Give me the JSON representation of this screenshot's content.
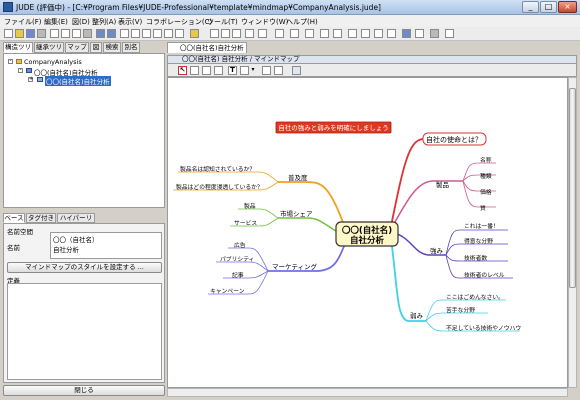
{
  "window": {
    "title": "JUDE  (評価中)  - [C:¥Program Files¥JUDE-Professional¥template¥mindmap¥CompanyAnalysis.jude]",
    "min_btn": "_",
    "max_btn": "□",
    "close_btn": "×"
  },
  "menu": [
    "ファイル(F)",
    "編集(E)",
    "図(D)",
    "整列(A)",
    "表示(V)",
    "コラボレーション(C)",
    "ツール(T)",
    "ウィンドウ(W)",
    "ヘルプ(H)"
  ],
  "left_tabs": [
    "構造ツリー",
    "継承ツリー",
    "マップ",
    "図",
    "検索",
    "別名"
  ],
  "tree": {
    "root": "CompanyAnalysis",
    "child": "〇〇(自社名)自社分析",
    "selected": "〇〇(自社名)自社分析"
  },
  "props": {
    "tabs": [
      "ベース",
      "タグ付き値",
      "ハイパーリンク"
    ],
    "namespace_label": "名前空間",
    "name_label": "名前",
    "name_value_line1": "〇〇（自社名）",
    "name_value_line2": "自社分析",
    "style_button": "マインドマップのスタイルを設定する ...",
    "definition_label": "定義",
    "close_button": "閉じる"
  },
  "editor": {
    "tab_label": "〇〇(自社名)自社分析",
    "header": "〇〇(自社名) 自社分析 / マインドマップ",
    "tools": [
      "select",
      "curve",
      "line",
      "link",
      "text",
      "shape",
      "dropdown",
      "pen",
      "node",
      "image"
    ],
    "tool_text": "T"
  },
  "mindmap": {
    "center_line1": "〇〇(自社名)",
    "center_line2": "自社分析",
    "note": "自社の強みと弱みを明確にしましょう",
    "mission": "自社の使命とは？",
    "products": "製品",
    "products_items": [
      "名称",
      "種類",
      "価格",
      "質"
    ],
    "strength": "強み",
    "strength_items": [
      "これは一番！",
      "得意な分野",
      "技術者数",
      "技術者のレベル"
    ],
    "weakness": "弱み",
    "weakness_items": [
      "ここはごめんなさい。",
      "苦手な分野",
      "不足している技術やノウハウ"
    ],
    "popularity": "普及度",
    "popularity_items": [
      "製品名は認知されているか？",
      "製品はどの程度浸透しているか？"
    ],
    "share": "市場シェア",
    "share_items": [
      "製品",
      "サービス"
    ],
    "marketing": "マーケティング",
    "marketing_items": [
      "広告",
      "パブリシティ",
      "記事",
      "キャンペーン"
    ],
    "colors": {
      "mission": "#e03030",
      "products": "#d05890",
      "strength": "#6040c0",
      "weakness": "#40d0e8",
      "popularity": "#f0a020",
      "share": "#70c040",
      "marketing": "#7070e0",
      "center_fill": "#fff7c8",
      "note_fill": "#e03820"
    }
  }
}
